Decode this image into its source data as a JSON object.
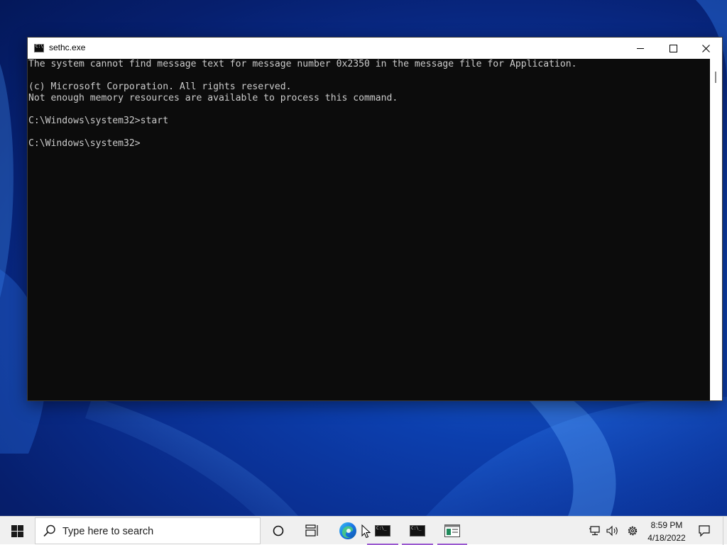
{
  "window": {
    "title": "sethc.exe",
    "icon": "cmd-icon",
    "controls": [
      "minimize-icon",
      "maximize-icon",
      "close-icon"
    ]
  },
  "console": {
    "lines": [
      "The system cannot find message text for message number 0x2350 in the message file for Application.",
      "",
      "(c) Microsoft Corporation. All rights reserved.",
      "Not enough memory resources are available to process this command.",
      "",
      "C:\\Windows\\system32>start",
      "",
      "C:\\Windows\\system32>"
    ]
  },
  "taskbar": {
    "search_placeholder": "Type here to search",
    "pinned": [
      {
        "name": "edge",
        "icon": "edge-icon",
        "active": false
      },
      {
        "name": "cmd-1",
        "icon": "cmd-icon",
        "active": true
      },
      {
        "name": "cmd-2",
        "icon": "cmd-icon",
        "active": true
      },
      {
        "name": "manager",
        "icon": "window-manager-icon",
        "active": true
      }
    ],
    "tray": {
      "icons": [
        "network-icon",
        "volume-icon",
        "settings-icon",
        "notification-icon"
      ],
      "time": "8:59 PM",
      "date": "4/18/2022"
    }
  },
  "colors": {
    "console_bg": "#0c0c0c",
    "console_text": "#cccccc",
    "desktop": "#0a2f92",
    "taskbar": "#f0f0f0",
    "active_underline": "#9b59d0",
    "edge_blue": "#1a73e8"
  }
}
